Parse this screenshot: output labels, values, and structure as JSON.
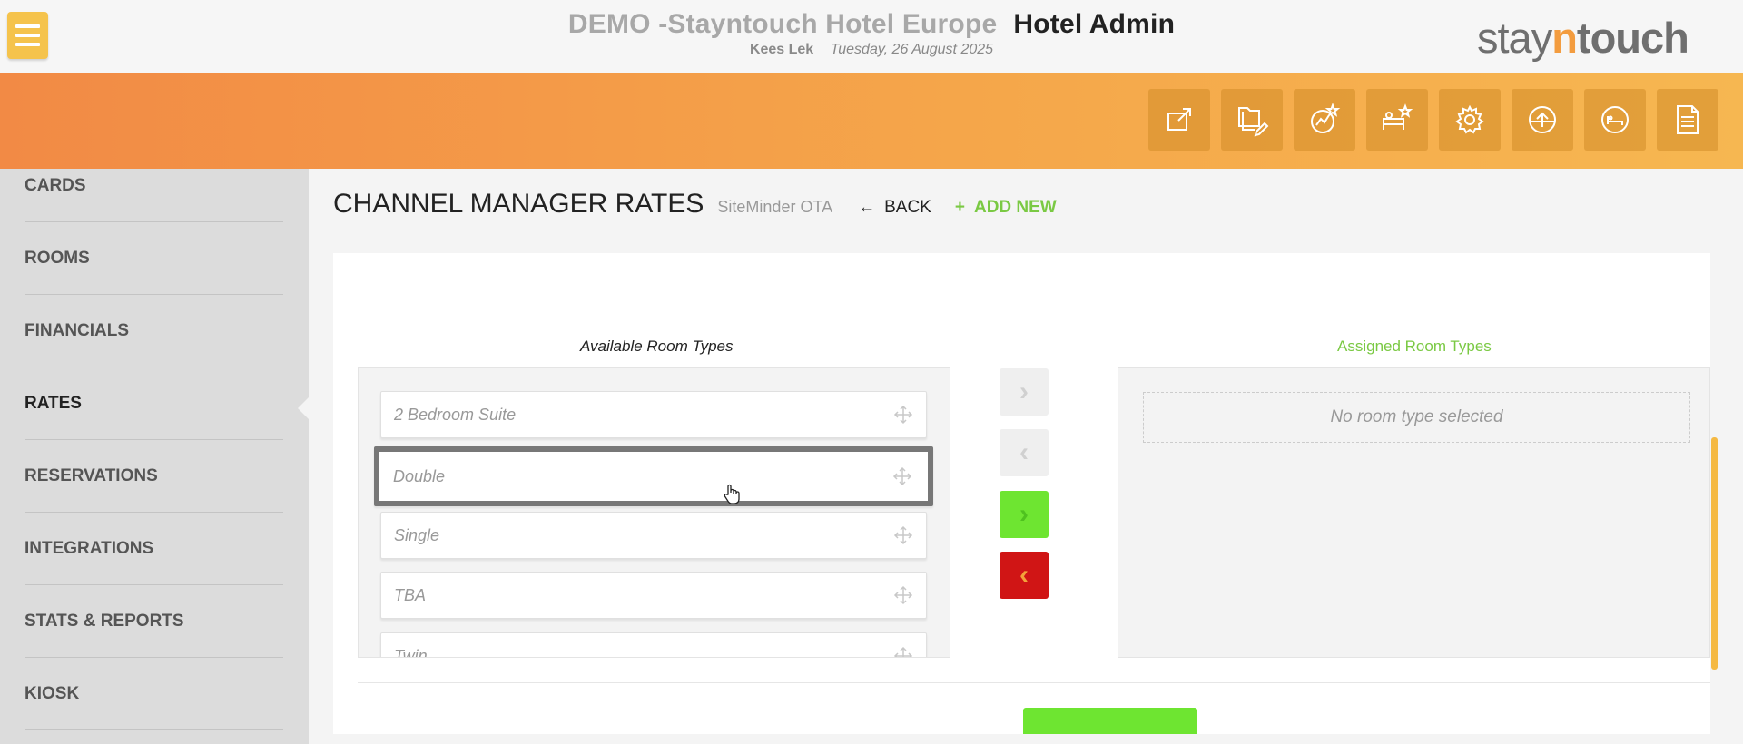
{
  "header": {
    "hotel_name": "DEMO -Stayntouch Hotel Europe",
    "app_name": "Hotel Admin",
    "user": "Kees Lek",
    "date": "Tuesday, 26 August 2025",
    "logo": {
      "part1": "stay",
      "part2": "n",
      "part3": "touch"
    }
  },
  "toolbar": {
    "icons": [
      "export-icon",
      "folder-edit-icon",
      "chart-star-icon",
      "room-star-icon",
      "settings-gear-icon",
      "upload-circle-icon",
      "bed-circle-icon",
      "document-icon"
    ]
  },
  "sidebar": {
    "items": [
      {
        "label": "CARDS"
      },
      {
        "label": "ROOMS"
      },
      {
        "label": "FINANCIALS"
      },
      {
        "label": "RATES",
        "active": true
      },
      {
        "label": "RESERVATIONS"
      },
      {
        "label": "INTEGRATIONS"
      },
      {
        "label": "STATS & REPORTS"
      },
      {
        "label": "KIOSK"
      }
    ]
  },
  "page": {
    "title": "CHANNEL MANAGER RATES",
    "subtitle": "SiteMinder OTA",
    "back_label": "BACK",
    "add_new_label": "ADD NEW"
  },
  "available": {
    "title": "Available Room Types",
    "rooms": [
      "2 Bedroom Suite",
      "Double",
      "Single",
      "TBA",
      "Twin"
    ],
    "selected_index": 1
  },
  "assigned": {
    "title": "Assigned Room Types",
    "empty_text": "No room type selected"
  },
  "colors": {
    "accent_orange": "#f28a45",
    "green": "#6ee531",
    "red": "#d01515",
    "menu_yellow": "#f5c34c"
  }
}
